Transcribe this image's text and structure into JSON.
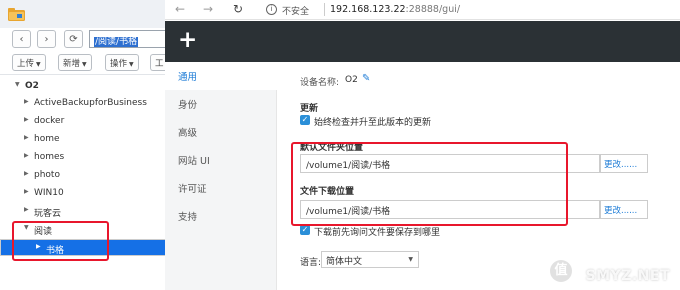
{
  "file_station": {
    "path_value": "/阅读/书格",
    "toolbar": [
      {
        "label": "上传"
      },
      {
        "label": "新增"
      },
      {
        "label": "操作"
      },
      {
        "label": "工"
      }
    ],
    "tree": {
      "root": "O2",
      "items": [
        {
          "label": "ActiveBackupforBusiness"
        },
        {
          "label": "docker"
        },
        {
          "label": "home"
        },
        {
          "label": "homes"
        },
        {
          "label": "photo"
        },
        {
          "label": "WIN10"
        },
        {
          "label": "玩客云"
        },
        {
          "label": "阅读"
        },
        {
          "label": "书格"
        }
      ]
    }
  },
  "browser": {
    "security_label": "不安全",
    "url_host": "192.168.123.22",
    "url_path": ":28888/gui/"
  },
  "gui": {
    "sidebar": [
      {
        "label": "通用"
      },
      {
        "label": "身份"
      },
      {
        "label": "高级"
      },
      {
        "label": "网站 UI"
      },
      {
        "label": "许可证"
      },
      {
        "label": "支持"
      }
    ],
    "device_name_label": "设备名称:",
    "device_name_value": "O2",
    "update_heading": "更新",
    "update_check_label": "始终检查并升至此版本的更新",
    "default_folder_heading": "默认文件夹位置",
    "default_folder_value": "/volume1/阅读/书格",
    "change_button": "更改......",
    "download_heading": "文件下载位置",
    "download_value": "/volume1/阅读/书格",
    "save_check_label": "下载前先询问文件要保存到哪里",
    "language_label": "语言:",
    "language_value": "简体中文"
  },
  "watermark": {
    "badge": "值",
    "text": "SMYZ.NET"
  },
  "colors": {
    "highlight_red": "#e8172c",
    "selected_blue": "#1570e6",
    "link_blue": "#1c7bd6",
    "gui_topbar": "#2b3135"
  }
}
